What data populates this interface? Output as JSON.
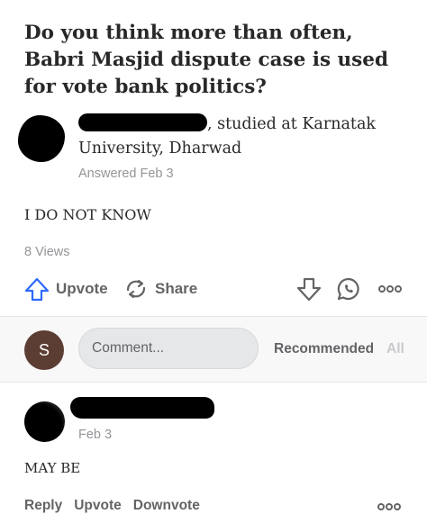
{
  "question": {
    "title": "Do you think more than often, Babri Masjid dispute case is used for vote bank politics?"
  },
  "answer": {
    "author_credential": ", studied at Karnatak University, Dharwad",
    "answered_date": "Answered Feb 3",
    "text": "I DO NOT KNOW",
    "views": "8 Views"
  },
  "actions": {
    "upvote_label": "Upvote",
    "share_label": "Share"
  },
  "comments_bar": {
    "user_initial": "S",
    "comment_placeholder": "Comment...",
    "sort_recommended": "Recommended",
    "sort_all": "All"
  },
  "comment": {
    "date": "Feb 3",
    "text": "MAY BE",
    "reply_label": "Reply",
    "upvote_label": "Upvote",
    "downvote_label": "Downvote"
  },
  "icons": {
    "upvote": "upvote-arrow-icon",
    "share": "share-icon",
    "downvote": "downvote-arrow-icon",
    "comment": "comment-bubble-icon",
    "more": "more-options-icon"
  },
  "colors": {
    "upvote_accent": "#2e69ff",
    "avatar_bg": "#5c3d33",
    "muted_text": "#939598",
    "action_text": "#636466"
  }
}
